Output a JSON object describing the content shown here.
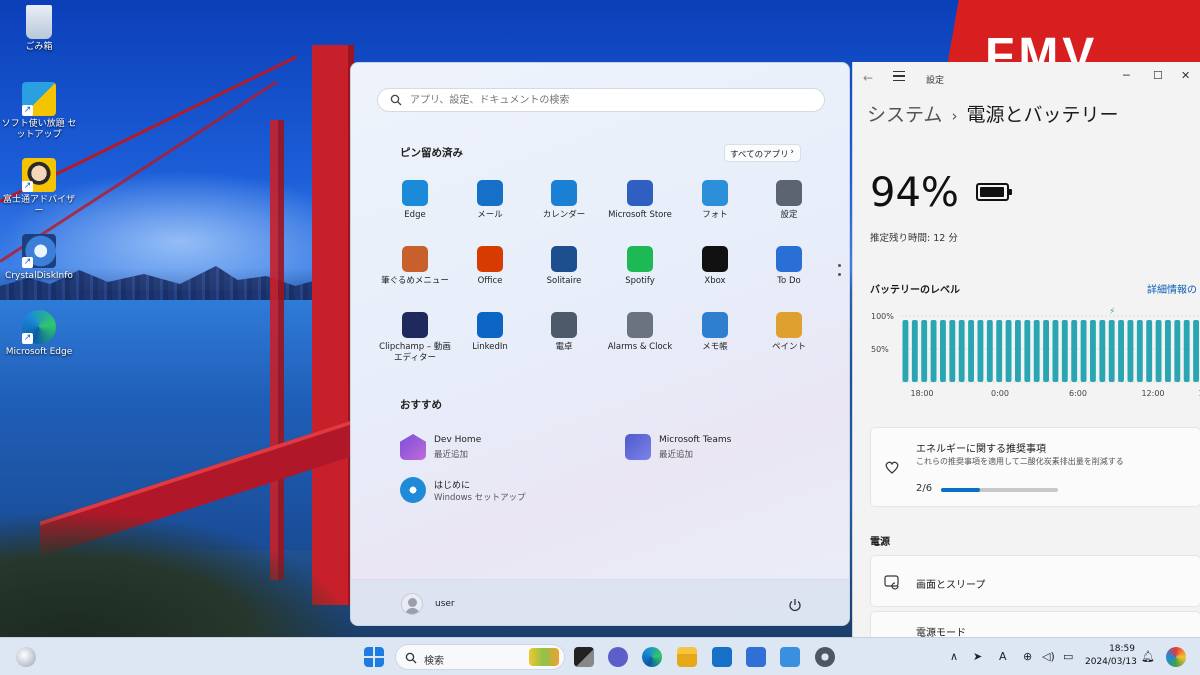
{
  "desktop": {
    "brand_text": "FMV",
    "icons": [
      {
        "label": "ごみ箱",
        "icon": "recycle-bin-icon"
      },
      {
        "label": "ソフト使い放題 セットアップ",
        "icon": "software-setup-icon"
      },
      {
        "label": "富士通アドバイザー",
        "icon": "fujitsu-advisor-icon"
      },
      {
        "label": "CrystalDiskInfo",
        "icon": "crystaldiskinfo-icon"
      },
      {
        "label": "Microsoft Edge",
        "icon": "edge-icon"
      }
    ]
  },
  "start_menu": {
    "search_placeholder": "アプリ、設定、ドキュメントの検索",
    "pinned_title": "ピン留め済み",
    "all_apps_label": "すべてのアプリ",
    "pinned": [
      {
        "label": "Edge",
        "icon": "edge-icon",
        "color": "#1b8ad8"
      },
      {
        "label": "メール",
        "icon": "mail-icon",
        "color": "#1670c8"
      },
      {
        "label": "カレンダー",
        "icon": "calendar-icon",
        "color": "#1b7fd4"
      },
      {
        "label": "Microsoft Store",
        "icon": "store-icon",
        "color": "#2f5fc0"
      },
      {
        "label": "フォト",
        "icon": "photos-icon",
        "color": "#2b8fd9"
      },
      {
        "label": "設定",
        "icon": "settings-icon",
        "color": "#5b6470"
      },
      {
        "label": "筆ぐるめメニュー",
        "icon": "fudegurume-icon",
        "color": "#c7602a"
      },
      {
        "label": "Office",
        "icon": "office-icon",
        "color": "#d83b01"
      },
      {
        "label": "Solitaire",
        "icon": "solitaire-icon",
        "color": "#1d4f8f"
      },
      {
        "label": "Spotify",
        "icon": "spotify-icon",
        "color": "#1db954"
      },
      {
        "label": "Xbox",
        "icon": "xbox-icon",
        "color": "#111111"
      },
      {
        "label": "To Do",
        "icon": "todo-icon",
        "color": "#2a6fd6"
      },
      {
        "label": "Clipchamp – 動画エディター",
        "icon": "clipchamp-icon",
        "color": "#1e2a5c"
      },
      {
        "label": "LinkedIn",
        "icon": "linkedin-icon",
        "color": "#0a66c2"
      },
      {
        "label": "電卓",
        "icon": "calculator-icon",
        "color": "#4d5a6a"
      },
      {
        "label": "Alarms & Clock",
        "icon": "alarm-clock-icon",
        "color": "#6b7280"
      },
      {
        "label": "メモ帳",
        "icon": "notepad-icon",
        "color": "#2f7fd0"
      },
      {
        "label": "ペイント",
        "icon": "paint-icon",
        "color": "#e0a030"
      }
    ],
    "recommended_title": "おすすめ",
    "recommended": [
      {
        "title": "Dev Home",
        "subtitle": "最近追加",
        "icon": "devhome-icon"
      },
      {
        "title": "Microsoft Teams",
        "subtitle": "最近追加",
        "icon": "teams-icon"
      },
      {
        "title": "はじめに",
        "subtitle": "Windows セットアップ",
        "icon": "get-started-icon"
      }
    ],
    "user_name": "user"
  },
  "settings": {
    "window_title": "設定",
    "breadcrumb_parent": "システム",
    "breadcrumb_sep": "›",
    "breadcrumb_current": "電源とバッテリー",
    "battery_percent": "94%",
    "battery_level": 0.94,
    "remaining_label": "推定残り時間:",
    "remaining_value": "12 分",
    "level_title": "バッテリーのレベル",
    "detail_link": "詳細情報の",
    "recommend_title": "エネルギーに関する推奨事項",
    "recommend_sub": "これらの推奨事項を適用して二酸化炭素排出量を削減する",
    "recommend_progress_label": "2/6",
    "recommend_progress": 0.333,
    "power_section": "電源",
    "screen_sleep": "画面とスリープ",
    "power_mode": "電源モード"
  },
  "chart_data": {
    "type": "bar",
    "title": "バッテリーのレベル",
    "y_tick_labels": [
      "100%",
      "50%"
    ],
    "x_tick_labels": [
      "18:00",
      "0:00",
      "6:00",
      "12:00",
      "1"
    ],
    "ylim": [
      0,
      100
    ],
    "values": [
      94,
      94,
      94,
      94,
      94,
      94,
      94,
      94,
      94,
      94,
      94,
      94,
      94,
      94,
      94,
      94,
      94,
      94,
      94,
      94,
      94,
      94,
      94,
      94,
      94,
      94,
      94,
      94,
      94,
      94,
      94,
      94
    ],
    "bar_color": "#2aa6b3",
    "charging_marker_index": 22
  },
  "taskbar": {
    "search_label": "検索",
    "ime_label": "A",
    "time": "18:59",
    "date": "2024/03/13",
    "colors": {
      "bg": "#dde6f3"
    }
  }
}
